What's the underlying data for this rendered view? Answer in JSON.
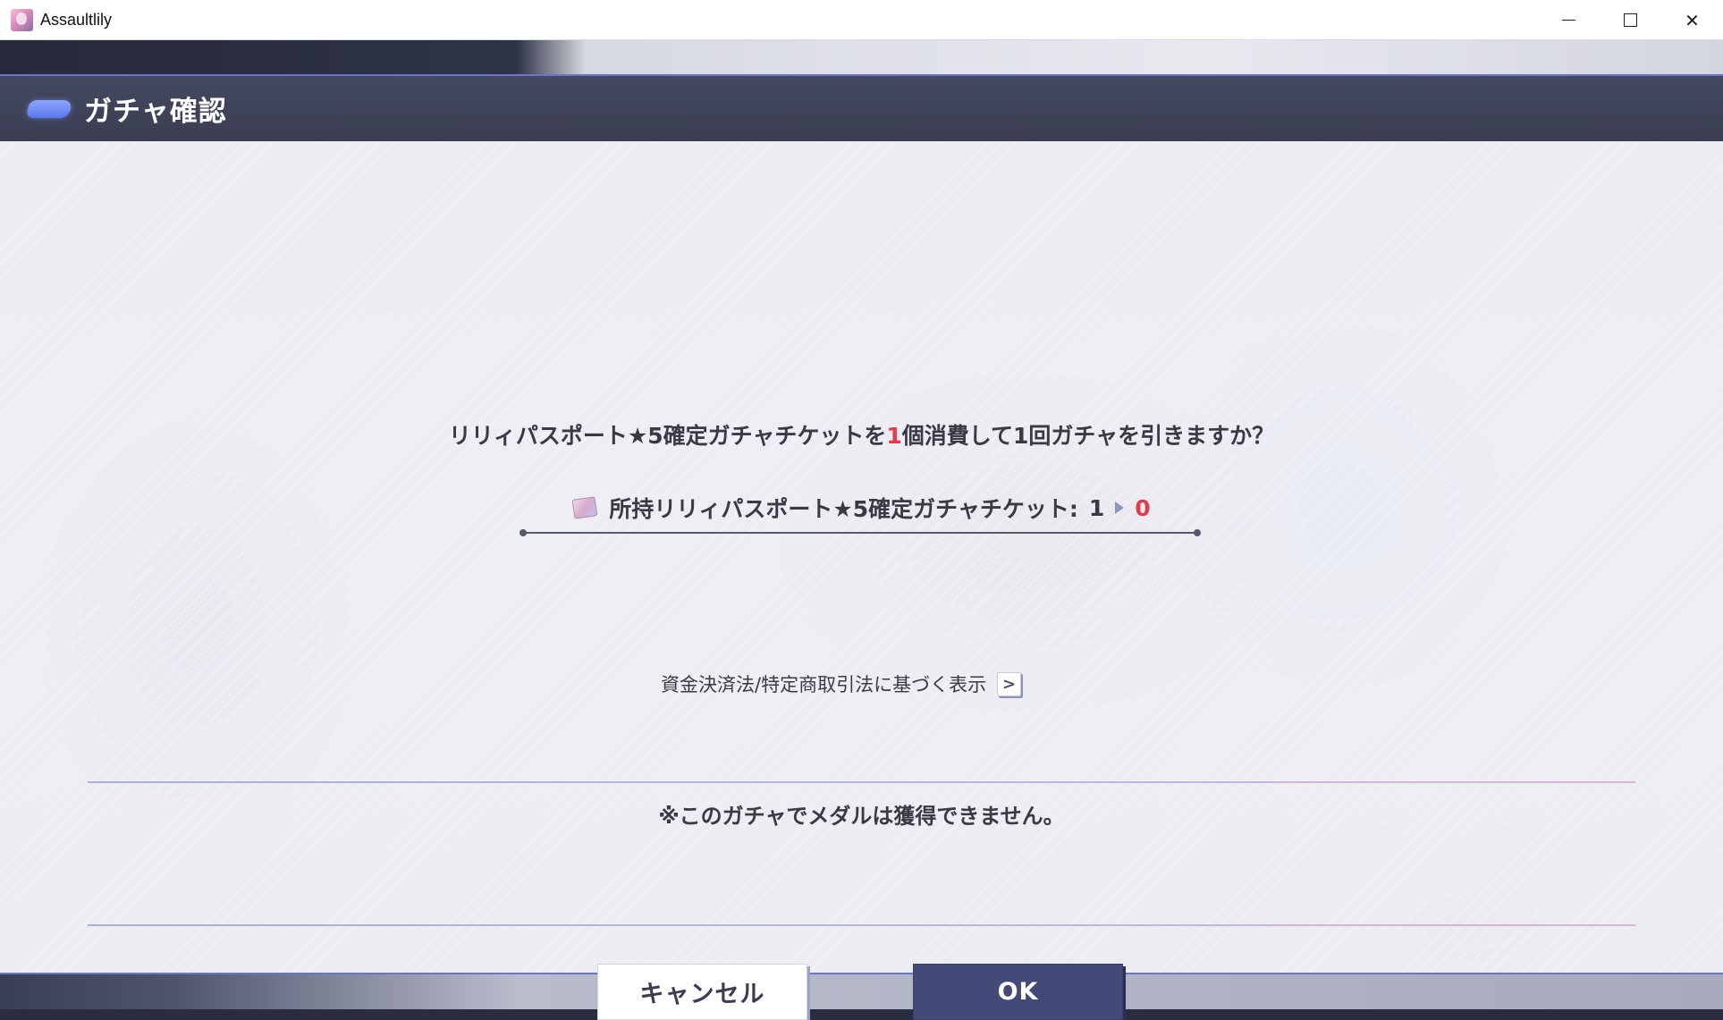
{
  "window": {
    "title": "Assaultlily",
    "icon": "app-icon",
    "controls": [
      "minimize-icon",
      "maximize-icon",
      "close-icon"
    ]
  },
  "dialog": {
    "title": "ガチャ確認",
    "message_prefix": "リリィパスポート★5確定ガチャチケットを",
    "message_count": "1",
    "message_suffix": "個消費して1回ガチャを引きますか？",
    "ticket": {
      "icon": "ticket-icon",
      "label": "所持リリィパスポート★5確定ガチャチケット:",
      "before": "1",
      "after": "0"
    },
    "legal_link": "資金決済法/特定商取引法に基づく表示",
    "legal_arrow": ">",
    "note": "※このガチャでメダルは獲得できません。",
    "buttons": {
      "cancel": "キャンセル",
      "ok": "OK"
    }
  },
  "colors": {
    "header_bg": "#3f4358",
    "accent_red": "#e2394e",
    "ok_button": "#444a78",
    "header_pill": "#6f8cf5"
  }
}
